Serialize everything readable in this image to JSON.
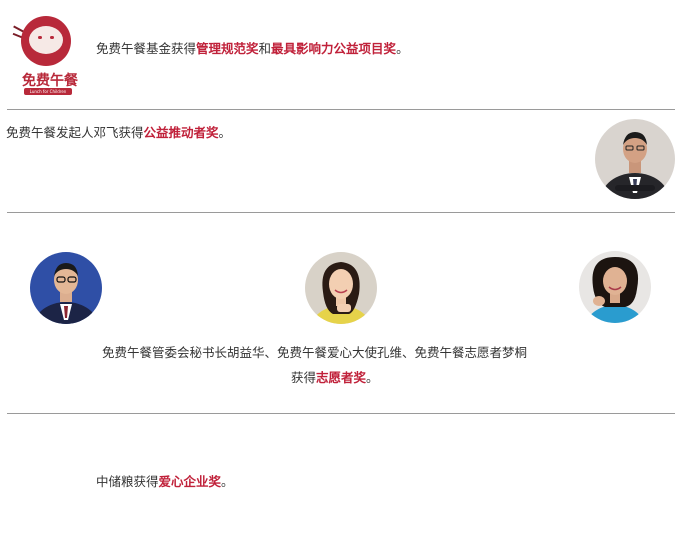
{
  "section1": {
    "logo_text": "免费午餐",
    "logo_ribbon": "Lunch for Children",
    "prefix": "免费午餐基金获得",
    "award1": "管理规范奖",
    "joiner": "和",
    "award2": "最具影响力公益项目奖",
    "suffix": "。"
  },
  "section2": {
    "prefix": "免费午餐发起人邓飞获得",
    "award": "公益推动者奖",
    "suffix": "。"
  },
  "section3": {
    "line1": "免费午餐管委会秘书长胡益华、免费午餐爱心大使孔维、免费午餐志愿者梦桐",
    "prefix": "获得",
    "award": "志愿者奖",
    "suffix": "。"
  },
  "section4": {
    "prefix": "中储粮获得",
    "award": "爱心企业奖",
    "suffix": "。"
  },
  "colors": {
    "highlight": "#c0213a",
    "text": "#333333",
    "divider": "#9a9a9a"
  }
}
